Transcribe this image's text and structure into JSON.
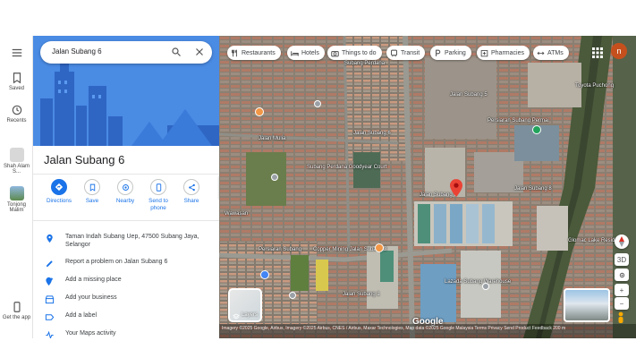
{
  "search": {
    "value": "Jalan Subang 6"
  },
  "rail": {
    "menu_icon": "menu-icon",
    "saved": "Saved",
    "recents": "Recents",
    "history": [
      {
        "label": "Shah Alam S..."
      },
      {
        "label": "Tonjong Malim"
      }
    ],
    "get_app": "Get the app"
  },
  "place": {
    "title": "Jalan Subang 6"
  },
  "actions": [
    {
      "label": "Directions",
      "icon": "directions-icon"
    },
    {
      "label": "Save",
      "icon": "bookmark-icon"
    },
    {
      "label": "Nearby",
      "icon": "nearby-icon"
    },
    {
      "label": "Send to phone",
      "icon": "phone-icon"
    },
    {
      "label": "Share",
      "icon": "share-icon"
    }
  ],
  "details": [
    {
      "text": "Taman Indah Subang Uep, 47500 Subang Jaya, Selangor",
      "icon": "location-pin-icon"
    },
    {
      "text": "Report a problem on Jalan Subang 6",
      "icon": "edit-icon"
    },
    {
      "text": "Add a missing place",
      "icon": "add-place-icon"
    },
    {
      "text": "Add your business",
      "icon": "business-icon"
    },
    {
      "text": "Add a label",
      "icon": "label-icon"
    },
    {
      "text": "Your Maps activity",
      "icon": "activity-icon"
    }
  ],
  "chips": [
    {
      "label": "Restaurants",
      "icon": "restaurant-icon"
    },
    {
      "label": "Hotels",
      "icon": "hotel-icon"
    },
    {
      "label": "Things to do",
      "icon": "camera-icon"
    },
    {
      "label": "Transit",
      "icon": "transit-icon"
    },
    {
      "label": "Parking",
      "icon": "parking-icon"
    },
    {
      "label": "Pharmacies",
      "icon": "pharmacy-icon"
    },
    {
      "label": "ATMs",
      "icon": "atm-icon"
    }
  ],
  "account": {
    "initial": "n",
    "color": "#c5501e"
  },
  "map_labels": [
    "Subang Perdana",
    "Jalan Subang 5",
    "Toyota Puchong",
    "Jalan Mulia",
    "Jalan Subang 6",
    "Subang Perdana Goodyear Court",
    "Jalan Subang 6",
    "Wawasan",
    "Persiaran Subang",
    "Copper Mining Jalan Subang 3",
    "Jalan Subang 1",
    "Lazada Subang Warehouse",
    "Glomac Lake Residence",
    "Jalan Subang 8",
    "Persiaran Subang Permai"
  ],
  "layers": {
    "label": "Layers"
  },
  "attribution": "Imagery ©2025 Google, Airbus, Imagery ©2025 Airbus, CNES / Airbus, Maxar Technologies, Map data ©2025 Google   Malaysia   Terms   Privacy   Send Product Feedback   200 m",
  "google_logo": "Google",
  "tilt": "3D",
  "zoom": {
    "in": "+",
    "out": "−"
  },
  "colors": {
    "accent": "#1a73e8",
    "marker": "#ea4335",
    "hero": "#4285f4"
  }
}
